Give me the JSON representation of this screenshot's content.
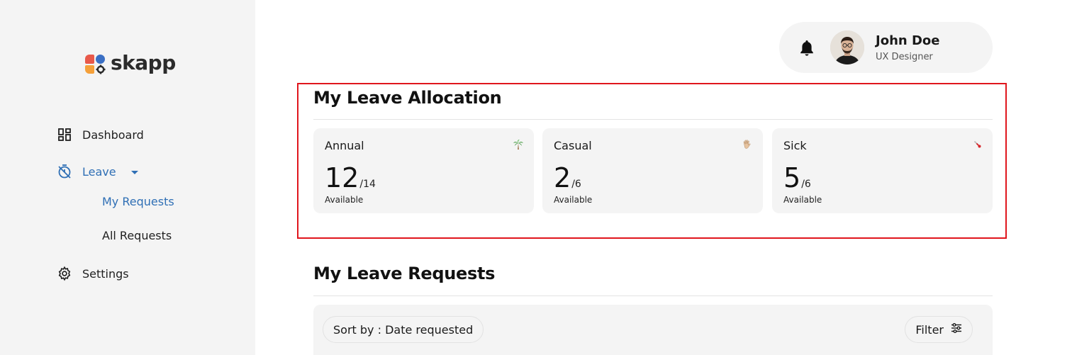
{
  "brand": {
    "name": "skapp"
  },
  "sidebar": {
    "items": [
      {
        "label": "Dashboard",
        "icon": "dashboard-icon"
      },
      {
        "label": "Leave",
        "icon": "timer-off-icon",
        "active": true
      },
      {
        "label": "Settings",
        "icon": "gear-icon"
      }
    ],
    "leave_sub": [
      {
        "label": "My Requests",
        "active": true
      },
      {
        "label": "All Requests"
      }
    ]
  },
  "header": {
    "user_name": "John Doe",
    "user_role": "UX Designer",
    "notification_icon": "bell-icon"
  },
  "allocation": {
    "title": "My Leave Allocation",
    "cards": [
      {
        "name": "Annual",
        "available": "12",
        "total": "/14",
        "label": "Available",
        "emoji": "palm-tree-icon"
      },
      {
        "name": "Casual",
        "available": "2",
        "total": "/6",
        "label": "Available",
        "emoji": "waving-hand-icon"
      },
      {
        "name": "Sick",
        "available": "5",
        "total": "/6",
        "label": "Available",
        "emoji": "thermometer-icon"
      }
    ]
  },
  "requests": {
    "title": "My Leave Requests",
    "sort_label": "Sort by : Date requested",
    "filter_label": "Filter"
  },
  "colors": {
    "accent": "#2f6fb5",
    "highlight": "#e0161d",
    "sidebar_bg": "#f4f4f4"
  }
}
